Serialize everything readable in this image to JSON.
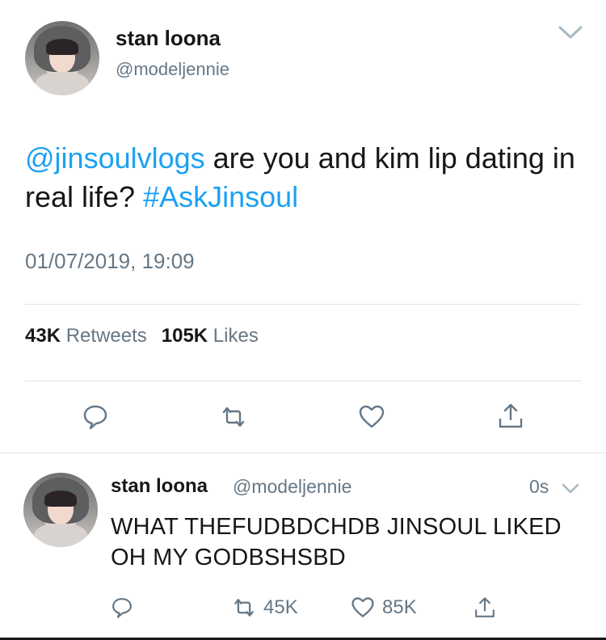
{
  "tweet": {
    "display_name": "stan loona",
    "handle": "@modeljennie",
    "text_mention": "@jinsoulvlogs",
    "text_body": " are you and kim lip dating in real life? ",
    "text_hashtag": "#AskJinsoul",
    "timestamp": "01/07/2019, 19:09",
    "retweets_count": "43K",
    "retweets_label": "Retweets",
    "likes_count": "105K",
    "likes_label": "Likes"
  },
  "reply": {
    "display_name": "stan loona",
    "handle": "@modeljennie",
    "time": "0s",
    "text": "WHAT THEFUDBDCHDB JINSOUL LIKED OH MY GODBSHSBD",
    "retweets": "45K",
    "likes": "85K"
  },
  "colors": {
    "accent": "#1da1f2",
    "secondary_text": "#657786",
    "primary_text": "#14171a",
    "divider": "#dfe3e6"
  },
  "icons": [
    "chevron-down-icon",
    "reply-icon",
    "retweet-icon",
    "like-icon",
    "share-icon"
  ]
}
